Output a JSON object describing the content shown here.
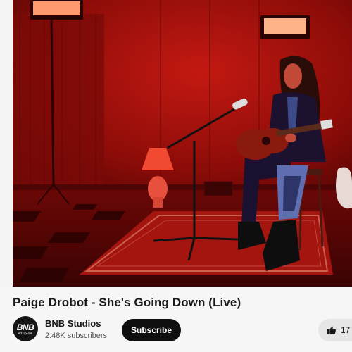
{
  "video": {
    "title": "Paige Drobot - She's Going Down (Live)"
  },
  "channel": {
    "name": "BNB Studios",
    "subscribers": "2.48K subscribers",
    "avatar_text": "BNB",
    "avatar_subtext": "STUDIOS"
  },
  "actions": {
    "subscribe_label": "Subscribe",
    "like_count": "17",
    "like_icon": "thumbs-up-icon"
  },
  "colors": {
    "subscribe_bg": "#0f0f0f",
    "scene_red": "#b3100c"
  }
}
